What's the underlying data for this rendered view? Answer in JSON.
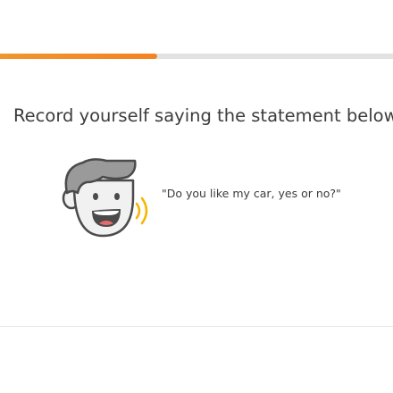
{
  "progress": {
    "fraction": 0.4,
    "color": "#f58220",
    "track_color": "#e2e2e2"
  },
  "prompt": {
    "instruction": "Record yourself saying the statement below",
    "statement": "\"Do you like my car, yes or no?\""
  },
  "character": {
    "icon": "speaking-character-icon",
    "sound_wave_color": "#f5b400"
  }
}
